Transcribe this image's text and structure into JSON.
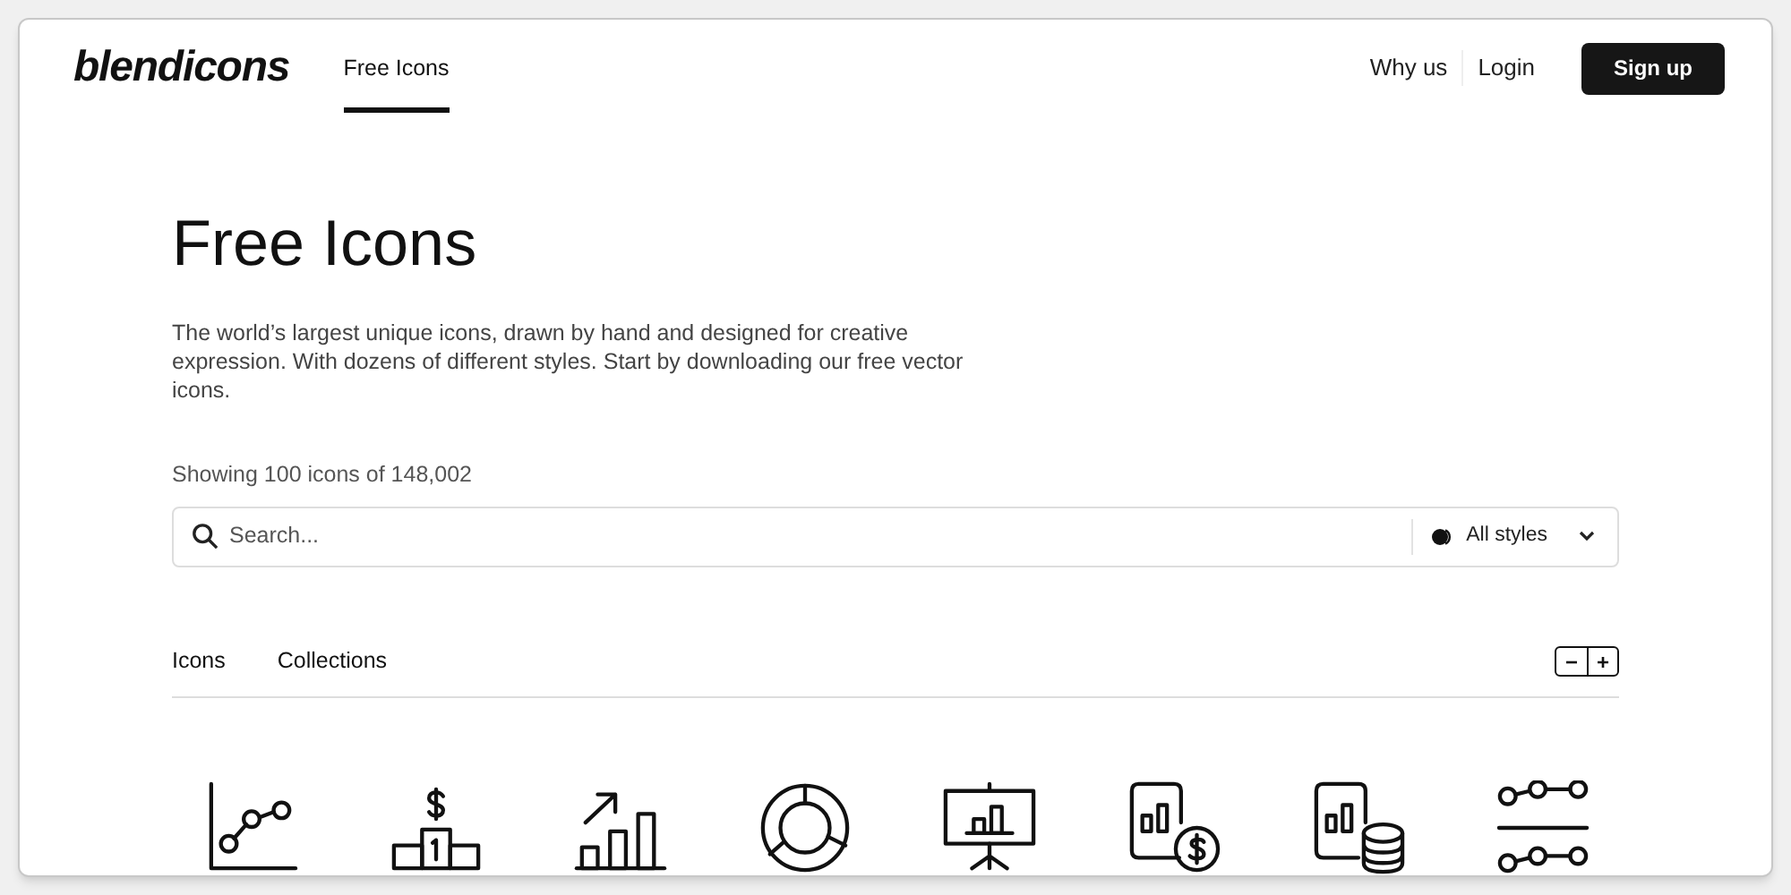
{
  "header": {
    "logo": "blendicons",
    "nav": [
      {
        "label": "Free Icons",
        "selected": true
      }
    ],
    "links": [
      "Why us",
      "Login"
    ],
    "signup": "Sign up"
  },
  "hero": {
    "title": "Free Icons",
    "description": "The world’s largest unique icons, drawn by hand and designed for creative expression. With dozens of different styles. Start by downloading our free vector icons."
  },
  "count": "Showing 100 icons of 148,002",
  "search": {
    "placeholder": "Search...",
    "style_filter": "All styles"
  },
  "tabs": [
    "Icons",
    "Collections"
  ],
  "zoom_controls": [
    "−",
    "+"
  ],
  "icons": [
    {
      "kind": "line-chart"
    },
    {
      "kind": "podium"
    },
    {
      "kind": "growth-bars"
    },
    {
      "kind": "donut"
    },
    {
      "kind": "presentation"
    },
    {
      "kind": "report-dollar"
    },
    {
      "kind": "report-coins"
    },
    {
      "kind": "sliders"
    }
  ]
}
